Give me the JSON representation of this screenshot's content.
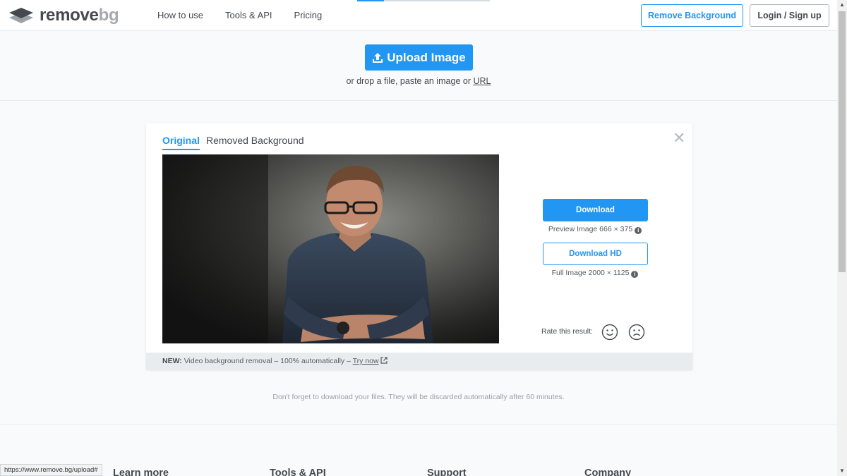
{
  "header": {
    "logo": {
      "word1": "remove",
      "word2": "bg"
    },
    "nav": [
      "How to use",
      "Tools & API",
      "Pricing"
    ],
    "remove_background_label": "Remove Background",
    "login_label": "Login / Sign up"
  },
  "upload": {
    "button_label": "Upload Image",
    "drop_text_prefix": "or drop a file, paste an image or ",
    "url_link": "URL"
  },
  "result": {
    "tabs": {
      "original": "Original",
      "removed": "Removed Background"
    },
    "close_glyph": "✕",
    "download_label": "Download",
    "preview_info": "Preview Image 666 × 375",
    "download_hd_label": "Download HD",
    "full_info": "Full Image 2000 × 1125",
    "rate_label": "Rate this result:",
    "info_glyph": "i",
    "footer": {
      "new_label": "NEW:",
      "text": " Video background removal – 100% automatically – ",
      "link": "Try now"
    }
  },
  "discard_note": "Don't forget to download your files. They will be discarded automatically after 60 minutes.",
  "footer_columns": [
    "Learn more",
    "Tools & API",
    "Support",
    "Company"
  ],
  "status_url": "https://www.remove.bg/upload#",
  "colors": {
    "accent": "#2196f3",
    "text": "#45494e"
  }
}
